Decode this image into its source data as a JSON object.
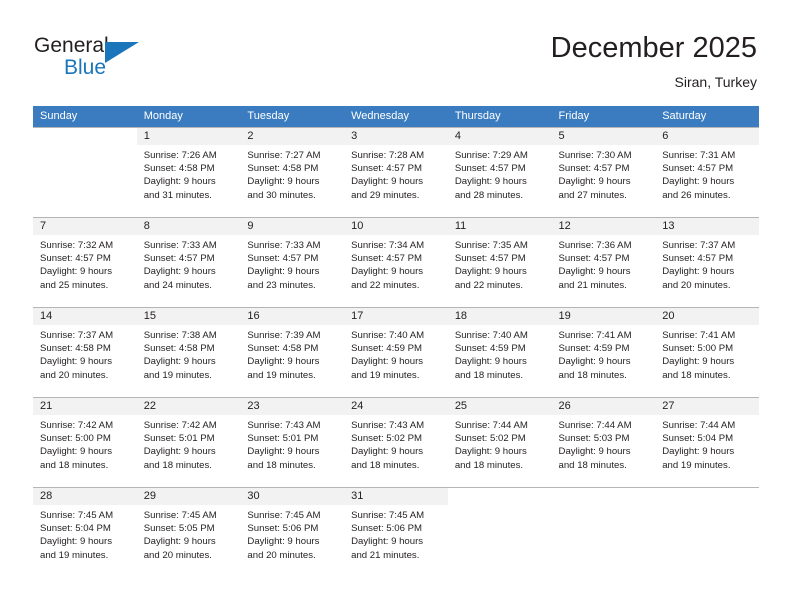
{
  "brand": {
    "name_part1": "General",
    "name_part2": "Blue",
    "flag_icon": "triangle-flag-icon"
  },
  "header": {
    "month_title": "December 2025",
    "location": "Siran, Turkey"
  },
  "colors": {
    "header_row_bg": "#3a7cbf",
    "header_row_text": "#ffffff",
    "daynum_shaded_bg": "#f2f2f2",
    "brand_blue": "#1b75bb",
    "grid_line": "#b5b5b5",
    "text": "#231f20"
  },
  "weekday_headers": [
    "Sunday",
    "Monday",
    "Tuesday",
    "Wednesday",
    "Thursday",
    "Friday",
    "Saturday"
  ],
  "weeks": [
    [
      {
        "day": "",
        "lines": []
      },
      {
        "day": "1",
        "lines": [
          "Sunrise: 7:26 AM",
          "Sunset: 4:58 PM",
          "Daylight: 9 hours",
          "and 31 minutes."
        ]
      },
      {
        "day": "2",
        "lines": [
          "Sunrise: 7:27 AM",
          "Sunset: 4:58 PM",
          "Daylight: 9 hours",
          "and 30 minutes."
        ]
      },
      {
        "day": "3",
        "lines": [
          "Sunrise: 7:28 AM",
          "Sunset: 4:57 PM",
          "Daylight: 9 hours",
          "and 29 minutes."
        ]
      },
      {
        "day": "4",
        "lines": [
          "Sunrise: 7:29 AM",
          "Sunset: 4:57 PM",
          "Daylight: 9 hours",
          "and 28 minutes."
        ]
      },
      {
        "day": "5",
        "lines": [
          "Sunrise: 7:30 AM",
          "Sunset: 4:57 PM",
          "Daylight: 9 hours",
          "and 27 minutes."
        ]
      },
      {
        "day": "6",
        "lines": [
          "Sunrise: 7:31 AM",
          "Sunset: 4:57 PM",
          "Daylight: 9 hours",
          "and 26 minutes."
        ]
      }
    ],
    [
      {
        "day": "7",
        "lines": [
          "Sunrise: 7:32 AM",
          "Sunset: 4:57 PM",
          "Daylight: 9 hours",
          "and 25 minutes."
        ]
      },
      {
        "day": "8",
        "lines": [
          "Sunrise: 7:33 AM",
          "Sunset: 4:57 PM",
          "Daylight: 9 hours",
          "and 24 minutes."
        ]
      },
      {
        "day": "9",
        "lines": [
          "Sunrise: 7:33 AM",
          "Sunset: 4:57 PM",
          "Daylight: 9 hours",
          "and 23 minutes."
        ]
      },
      {
        "day": "10",
        "lines": [
          "Sunrise: 7:34 AM",
          "Sunset: 4:57 PM",
          "Daylight: 9 hours",
          "and 22 minutes."
        ]
      },
      {
        "day": "11",
        "lines": [
          "Sunrise: 7:35 AM",
          "Sunset: 4:57 PM",
          "Daylight: 9 hours",
          "and 22 minutes."
        ]
      },
      {
        "day": "12",
        "lines": [
          "Sunrise: 7:36 AM",
          "Sunset: 4:57 PM",
          "Daylight: 9 hours",
          "and 21 minutes."
        ]
      },
      {
        "day": "13",
        "lines": [
          "Sunrise: 7:37 AM",
          "Sunset: 4:57 PM",
          "Daylight: 9 hours",
          "and 20 minutes."
        ]
      }
    ],
    [
      {
        "day": "14",
        "lines": [
          "Sunrise: 7:37 AM",
          "Sunset: 4:58 PM",
          "Daylight: 9 hours",
          "and 20 minutes."
        ]
      },
      {
        "day": "15",
        "lines": [
          "Sunrise: 7:38 AM",
          "Sunset: 4:58 PM",
          "Daylight: 9 hours",
          "and 19 minutes."
        ]
      },
      {
        "day": "16",
        "lines": [
          "Sunrise: 7:39 AM",
          "Sunset: 4:58 PM",
          "Daylight: 9 hours",
          "and 19 minutes."
        ]
      },
      {
        "day": "17",
        "lines": [
          "Sunrise: 7:40 AM",
          "Sunset: 4:59 PM",
          "Daylight: 9 hours",
          "and 19 minutes."
        ]
      },
      {
        "day": "18",
        "lines": [
          "Sunrise: 7:40 AM",
          "Sunset: 4:59 PM",
          "Daylight: 9 hours",
          "and 18 minutes."
        ]
      },
      {
        "day": "19",
        "lines": [
          "Sunrise: 7:41 AM",
          "Sunset: 4:59 PM",
          "Daylight: 9 hours",
          "and 18 minutes."
        ]
      },
      {
        "day": "20",
        "lines": [
          "Sunrise: 7:41 AM",
          "Sunset: 5:00 PM",
          "Daylight: 9 hours",
          "and 18 minutes."
        ]
      }
    ],
    [
      {
        "day": "21",
        "lines": [
          "Sunrise: 7:42 AM",
          "Sunset: 5:00 PM",
          "Daylight: 9 hours",
          "and 18 minutes."
        ]
      },
      {
        "day": "22",
        "lines": [
          "Sunrise: 7:42 AM",
          "Sunset: 5:01 PM",
          "Daylight: 9 hours",
          "and 18 minutes."
        ]
      },
      {
        "day": "23",
        "lines": [
          "Sunrise: 7:43 AM",
          "Sunset: 5:01 PM",
          "Daylight: 9 hours",
          "and 18 minutes."
        ]
      },
      {
        "day": "24",
        "lines": [
          "Sunrise: 7:43 AM",
          "Sunset: 5:02 PM",
          "Daylight: 9 hours",
          "and 18 minutes."
        ]
      },
      {
        "day": "25",
        "lines": [
          "Sunrise: 7:44 AM",
          "Sunset: 5:02 PM",
          "Daylight: 9 hours",
          "and 18 minutes."
        ]
      },
      {
        "day": "26",
        "lines": [
          "Sunrise: 7:44 AM",
          "Sunset: 5:03 PM",
          "Daylight: 9 hours",
          "and 18 minutes."
        ]
      },
      {
        "day": "27",
        "lines": [
          "Sunrise: 7:44 AM",
          "Sunset: 5:04 PM",
          "Daylight: 9 hours",
          "and 19 minutes."
        ]
      }
    ],
    [
      {
        "day": "28",
        "lines": [
          "Sunrise: 7:45 AM",
          "Sunset: 5:04 PM",
          "Daylight: 9 hours",
          "and 19 minutes."
        ]
      },
      {
        "day": "29",
        "lines": [
          "Sunrise: 7:45 AM",
          "Sunset: 5:05 PM",
          "Daylight: 9 hours",
          "and 20 minutes."
        ]
      },
      {
        "day": "30",
        "lines": [
          "Sunrise: 7:45 AM",
          "Sunset: 5:06 PM",
          "Daylight: 9 hours",
          "and 20 minutes."
        ]
      },
      {
        "day": "31",
        "lines": [
          "Sunrise: 7:45 AM",
          "Sunset: 5:06 PM",
          "Daylight: 9 hours",
          "and 21 minutes."
        ]
      },
      {
        "day": "",
        "lines": []
      },
      {
        "day": "",
        "lines": []
      },
      {
        "day": "",
        "lines": []
      }
    ]
  ]
}
